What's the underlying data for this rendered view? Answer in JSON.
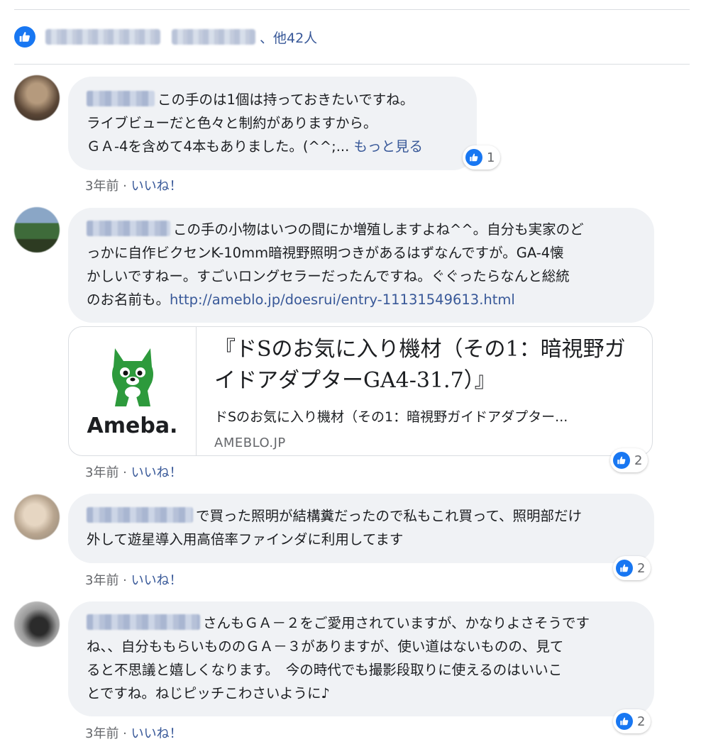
{
  "reactions_summary": {
    "text": "、他42人"
  },
  "comments": [
    {
      "text_lines": [
        "この手のは1個は持っておきたいですね。",
        "ライブビューだと色々と制約がありますから。",
        "ＧＡ-4を含めて4本もありました。(^^;..."
      ],
      "see_more": "もっと見る",
      "reaction_count": "1",
      "time": "3年前",
      "like_label": "いいね！"
    },
    {
      "text_lines": [
        "この手の小物はいつの間にか増殖しますよね^^。自分も実家のど",
        "っかに自作ビクセンK-10mm暗視野照明つきがあるはずなんですが。GA-4懐",
        "かしいですねー。すごいロングセラーだったんですね。ぐぐったらなんと総統",
        "のお名前も。"
      ],
      "link": "http://ameblo.jp/doesrui/entry-11131549613.html",
      "card": {
        "logo_text": "Ameba.",
        "title": "『ドSのお気に入り機材（その1：暗視野ガイドアダプターGA4-31.7）』",
        "description": "ドSのお気に入り機材（その1：暗視野ガイドアダプター...",
        "domain": "AMEBLO.JP"
      },
      "reaction_count": "2",
      "time": "3年前",
      "like_label": "いいね！"
    },
    {
      "text_lines": [
        "で買った照明が結構糞だったので私もこれ買って、照明部だけ",
        "外して遊星導入用高倍率ファインダに利用してます"
      ],
      "reaction_count": "2",
      "time": "3年前",
      "like_label": "いいね！"
    },
    {
      "text_lines": [
        "さんもＧＡ－２をご愛用されていますが、かなりよさそうです",
        "ね、、自分ももらいもののＧＡ－３がありますが、使い道はないものの、見て",
        "ると不思議と嬉しくなります。　今の時代でも撮影段取りに使えるのはいいこ",
        "とですね。ねじピッチこわさいように♪"
      ],
      "reaction_count": "2",
      "time": "3年前",
      "like_label": "いいね！"
    }
  ],
  "colors": {
    "accent": "#385898",
    "like_blue": "#1877f2",
    "bubble": "#f0f2f5",
    "meta": "#65676b",
    "ameba_green": "#2d9a3c"
  },
  "icons": {
    "like": "thumbs-up-icon"
  }
}
